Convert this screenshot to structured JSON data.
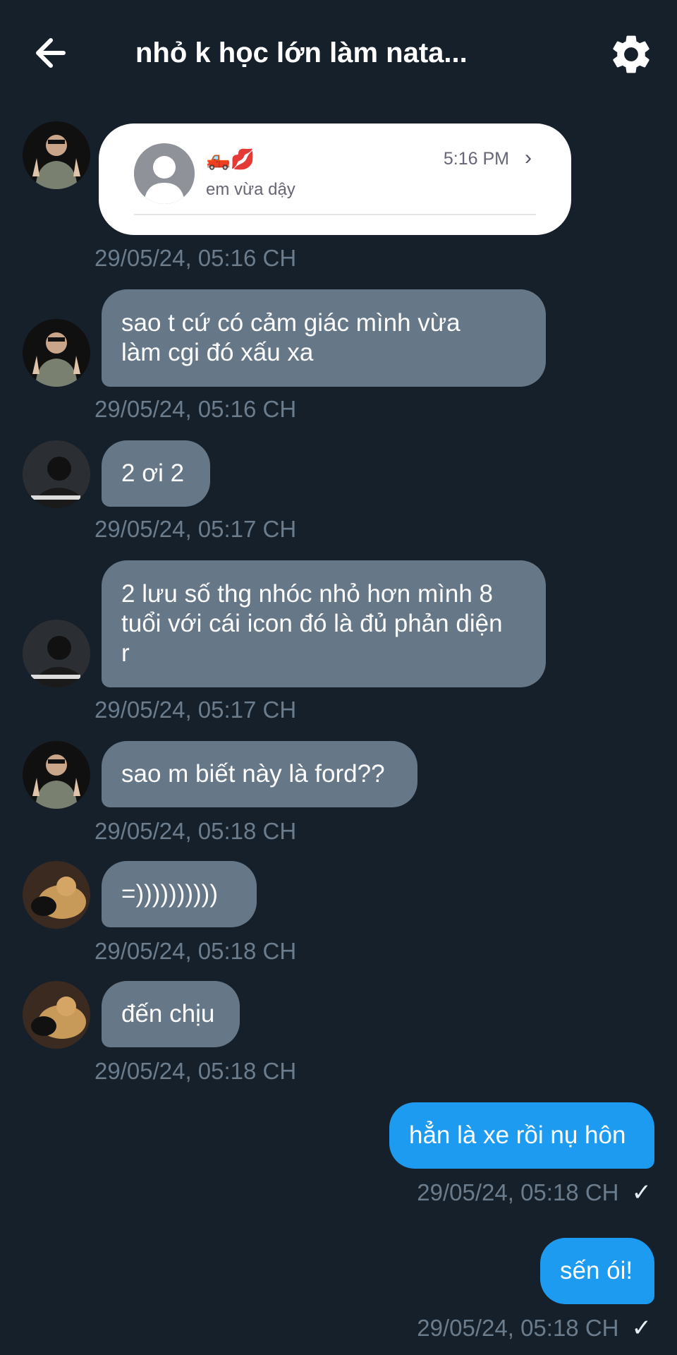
{
  "header": {
    "title": "nhỏ k học lớn làm nata...",
    "back_icon": "arrow-left-icon",
    "settings_icon": "gear-icon"
  },
  "shared_card": {
    "name_emoji": "🛻💋",
    "preview": "em vừa dậy",
    "time": "5:16 PM",
    "chevron": "›"
  },
  "messages": [
    {
      "text": "sao t cứ có cảm giác mình vừa\nlàm cgi đó xấu xa",
      "timestamp": "29/05/24, 05:16 CH"
    },
    {
      "text": "2 ơi 2",
      "timestamp": "29/05/24, 05:17 CH"
    },
    {
      "text": "2 lưu số thg nhóc nhỏ hơn mình 8\ntuổi với cái icon đó là đủ phản diện\nr",
      "timestamp": "29/05/24, 05:17 CH"
    },
    {
      "text": "sao m biết này là ford??",
      "timestamp": "29/05/24, 05:18 CH"
    },
    {
      "text": "=))))))))))",
      "timestamp": "29/05/24, 05:18 CH"
    },
    {
      "text": "đến chịu",
      "timestamp": "29/05/24, 05:18 CH"
    },
    {
      "text": "hẳn là xe rồi nụ hôn",
      "timestamp": "29/05/24, 05:18 CH",
      "read_mark": "✓"
    },
    {
      "text": "sến ói!",
      "timestamp": "29/05/24, 05:18 CH",
      "read_mark": "✓"
    }
  ],
  "card_timestamp": "29/05/24, 05:16 CH",
  "colors": {
    "background": "#16202b",
    "incoming_bubble": "#667788",
    "outgoing_bubble": "#1d9bf0",
    "timestamp": "#6b7c8c"
  }
}
